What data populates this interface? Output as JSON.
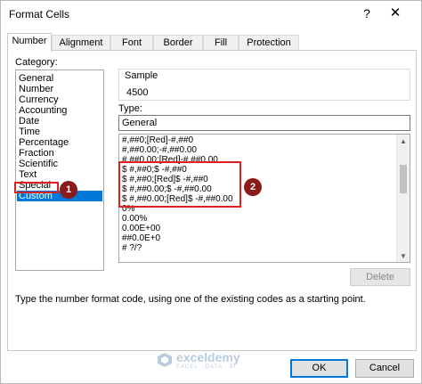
{
  "window": {
    "title": "Format Cells",
    "help_glyph": "?",
    "close_glyph": "✕"
  },
  "tabs": [
    {
      "label": "Number",
      "active": true
    },
    {
      "label": "Alignment",
      "active": false
    },
    {
      "label": "Font",
      "active": false
    },
    {
      "label": "Border",
      "active": false
    },
    {
      "label": "Fill",
      "active": false
    },
    {
      "label": "Protection",
      "active": false
    }
  ],
  "category": {
    "label": "Category:",
    "items": [
      "General",
      "Number",
      "Currency",
      "Accounting",
      "Date",
      "Time",
      "Percentage",
      "Fraction",
      "Scientific",
      "Text",
      "Special",
      "Custom"
    ],
    "selected": "Custom"
  },
  "sample": {
    "label": "Sample",
    "value": "4500"
  },
  "type": {
    "label": "Type:",
    "value": "General"
  },
  "formats": [
    "#,##0;[Red]-#,##0",
    "#,##0.00;-#,##0.00",
    "#,##0.00;[Red]-#,##0.00",
    "$ #,##0;$ -#,##0",
    "$ #,##0;[Red]$ -#,##0",
    "$ #,##0.00;$ -#,##0.00",
    "$ #,##0.00;[Red]$ -#,##0.00",
    "0%",
    "0.00%",
    "0.00E+00",
    "##0.0E+0",
    "# ?/?"
  ],
  "annotations": {
    "badge_1": "1",
    "badge_2": "2",
    "highlight_color": "#e02020",
    "badge_color": "#8b1a1a"
  },
  "buttons": {
    "delete": "Delete",
    "ok": "OK",
    "cancel": "Cancel"
  },
  "description": "Type the number format code, using one of the existing codes as a starting point.",
  "watermark": {
    "name": "exceldemy",
    "tagline": "EXCEL · DATA · BI"
  },
  "colors": {
    "selection": "#0078d7"
  }
}
